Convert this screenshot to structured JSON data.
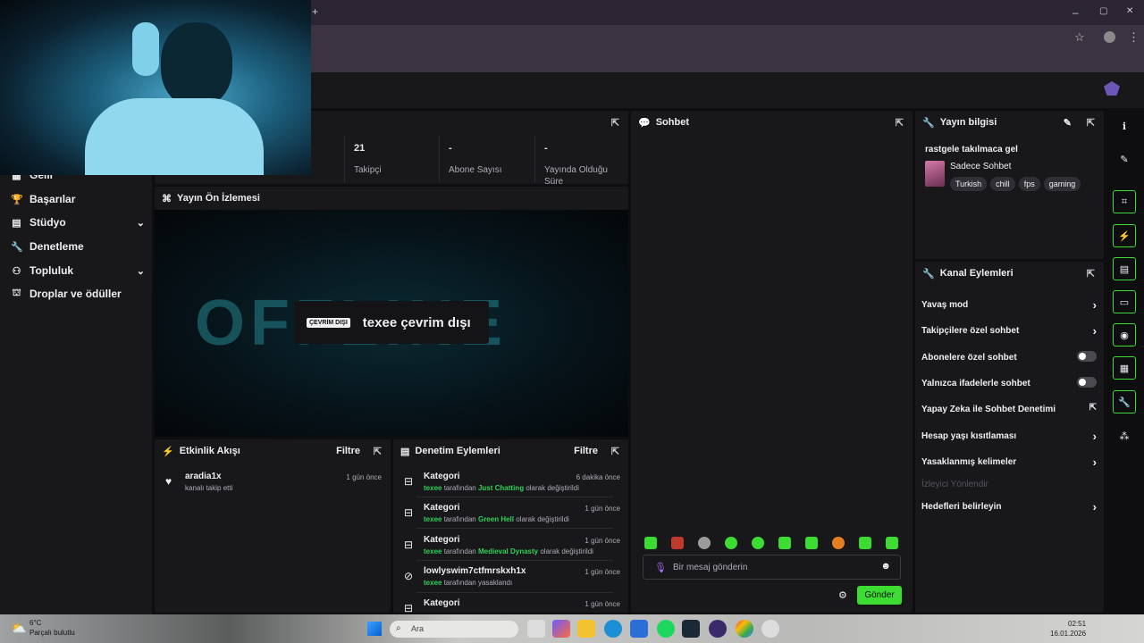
{
  "browser": {
    "new_tab": "+",
    "minimize": "–",
    "restore": "▢",
    "close": "✕",
    "star": "☆",
    "menu": "⋮"
  },
  "sidebar": {
    "items": [
      {
        "label": "Gelir",
        "icon": "money-icon"
      },
      {
        "label": "Başarılar",
        "icon": "trophy-icon"
      },
      {
        "label": "Stüdyo",
        "icon": "studio-icon",
        "expandable": true
      },
      {
        "label": "Denetleme",
        "icon": "wrench-icon"
      },
      {
        "label": "Topluluk",
        "icon": "community-icon",
        "expandable": true
      },
      {
        "label": "Droplar ve ödüller",
        "icon": "gift-icon"
      }
    ]
  },
  "stats": [
    {
      "value": "21",
      "label": "Takipçi"
    },
    {
      "value": "-",
      "label": "Abone Sayısı"
    },
    {
      "value": "-",
      "label": "Yayında Olduğu Süre"
    }
  ],
  "preview": {
    "title": "Yayın Ön İzlemesi",
    "offline_tag": "ÇEVRİM DIŞI",
    "offline_text": "texee çevrim dışı",
    "bg_text": "OFFLINE"
  },
  "activity": {
    "title": "Etkinlik Akışı",
    "filter": "Filtre",
    "rows": [
      {
        "user": "aradia1x",
        "desc": "kanalı takip etti",
        "time": "1 gün önce"
      }
    ]
  },
  "modlog": {
    "title": "Denetim Eylemleri",
    "filter": "Filtre",
    "rows": [
      {
        "title": "Kategori",
        "time": "6 dakika önce",
        "actor": "texee",
        "pre": "tarafından",
        "target": "Just Chatting",
        "post": "olarak değiştirildi"
      },
      {
        "title": "Kategori",
        "time": "1 gün önce",
        "actor": "texee",
        "pre": "tarafından",
        "target": "Green Hell",
        "post": "olarak değiştirildi"
      },
      {
        "title": "Kategori",
        "time": "1 gün önce",
        "actor": "texee",
        "pre": "tarafından",
        "target": "Medieval Dynasty",
        "post": "olarak değiştirildi"
      },
      {
        "title": "lowlyswim7ctfmrskxh1x",
        "time": "1 gün önce",
        "actor": "texee",
        "pre": "tarafından yasaklandı",
        "target": "",
        "post": ""
      },
      {
        "title": "Kategori",
        "time": "1 gün önce",
        "actor": "",
        "pre": "",
        "target": "",
        "post": ""
      }
    ]
  },
  "chat": {
    "title": "Sohbet",
    "placeholder": "Bir mesaj gönderin",
    "send": "Gönder"
  },
  "stream_info": {
    "title": "Yayın bilgisi",
    "stream_title": "rastgele takılmaca gel",
    "category": "Sadece Sohbet",
    "tags": [
      "Turkish",
      "chill",
      "fps",
      "gaming"
    ]
  },
  "channel_actions": {
    "title": "Kanal Eylemleri",
    "items": [
      {
        "label": "Yavaş mod",
        "control": "arrow"
      },
      {
        "label": "Takipçilere özel sohbet",
        "control": "arrow"
      },
      {
        "label": "Abonelere özel sohbet",
        "control": "toggle"
      },
      {
        "label": "Yalnızca ifadelerle sohbet",
        "control": "toggle"
      },
      {
        "label": "Yapay Zeka ile Sohbet Denetimi",
        "control": "external"
      },
      {
        "label": "Hesap yaşı kısıtlaması",
        "control": "arrow"
      },
      {
        "label": "Yasaklanmış kelimeler",
        "control": "arrow"
      },
      {
        "label": "İzleyici Yönlendir",
        "control": "none",
        "disabled": true
      },
      {
        "label": "Hedefleri belirleyin",
        "control": "arrow"
      }
    ]
  },
  "taskbar": {
    "weather_temp": "6°C",
    "weather_desc": "Parçalı bulutlu",
    "search": "Ara",
    "time": "02:51",
    "date": "16.01.2026"
  },
  "colors": {
    "accent": "#3ddc32",
    "panel": "#18181b",
    "bg": "#0e0e10"
  }
}
